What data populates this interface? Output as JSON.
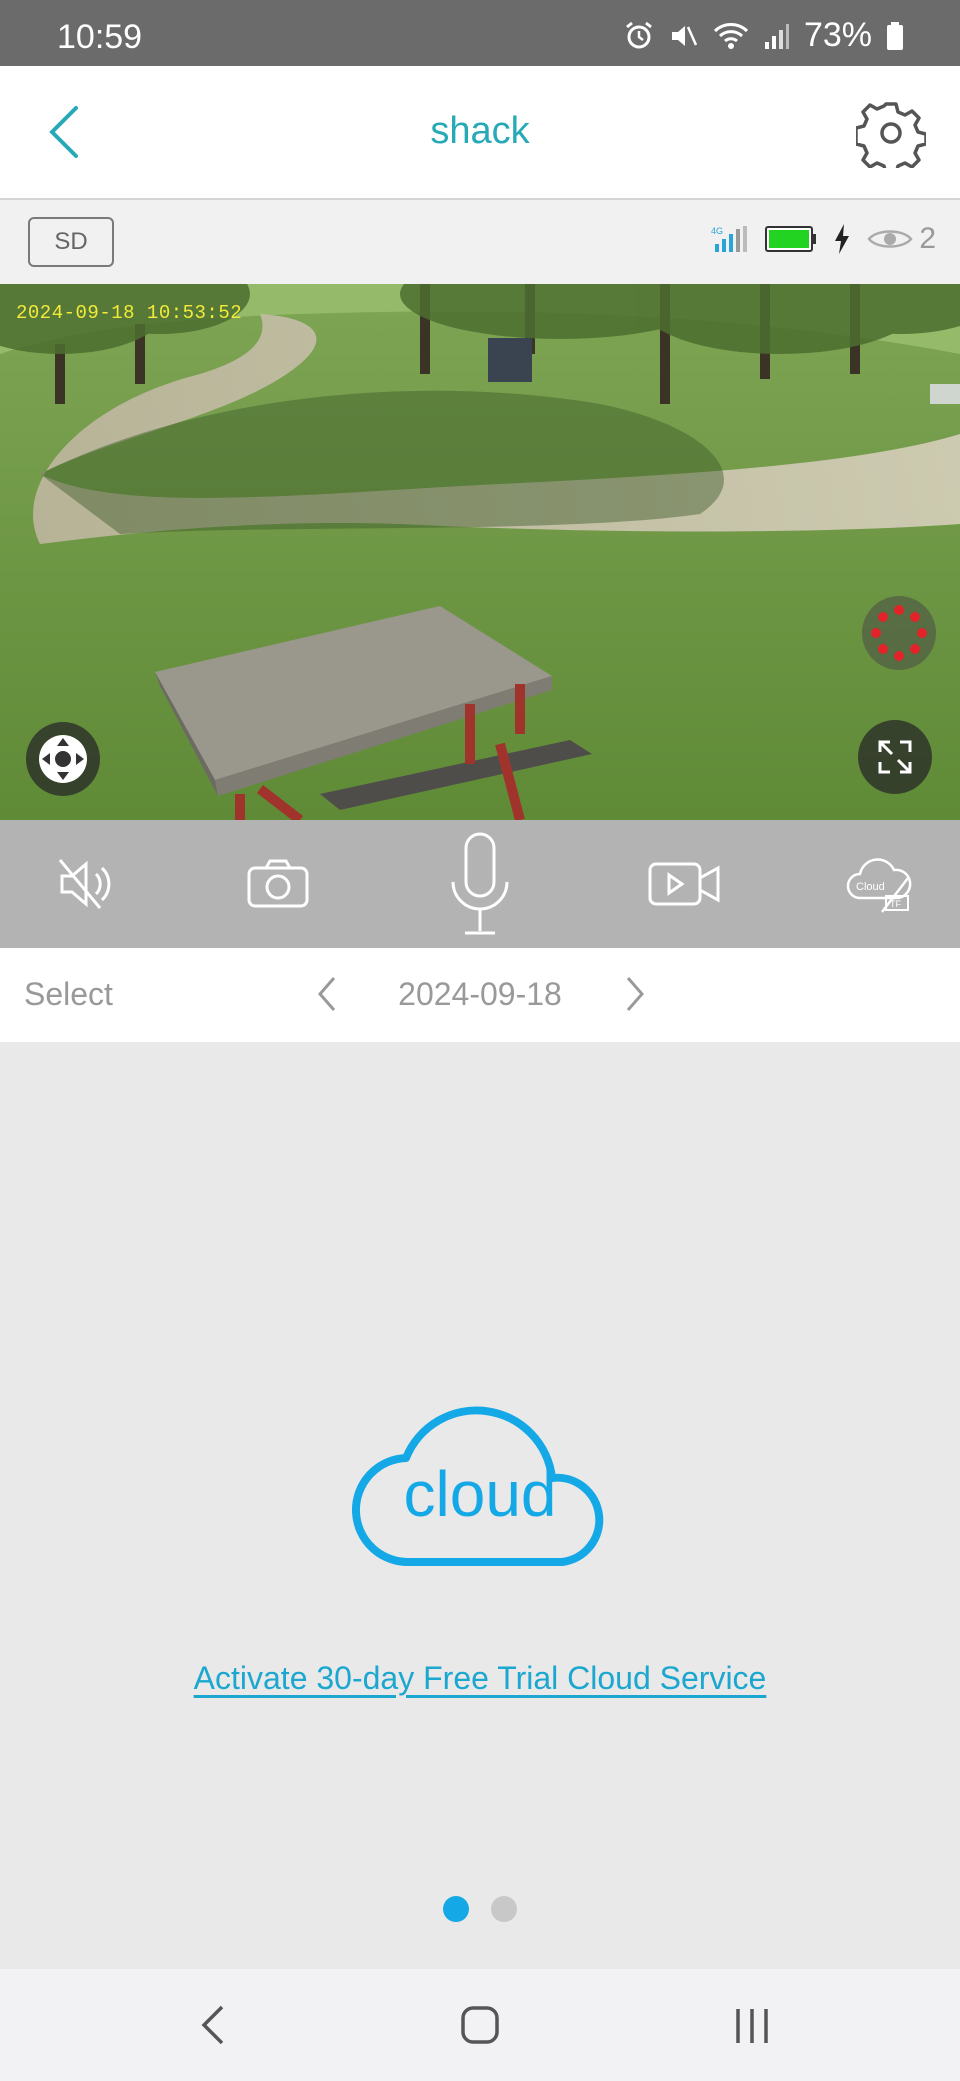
{
  "status_bar": {
    "time": "10:59",
    "battery": "73%",
    "icons": [
      "alarm-icon",
      "mute-icon",
      "wifi-icon",
      "signal-icon",
      "battery-icon"
    ]
  },
  "header": {
    "title": "shack",
    "back_icon": "chevron-left-icon",
    "settings_icon": "gear-icon",
    "accent": "#27a9b7"
  },
  "device_info": {
    "quality": "SD",
    "network": "4G",
    "battery_color": "#22d322",
    "viewer_count": "2"
  },
  "video": {
    "timestamp": "2024-09-18 10:53:52",
    "left_control_icon": "ptz-direction-icon",
    "right_top_control_icon": "record-indicator-icon",
    "fullscreen_icon": "fullscreen-icon"
  },
  "toolbar": {
    "items": [
      "speaker-mute-icon",
      "camera-snapshot-icon",
      "microphone-icon",
      "video-record-icon",
      "cloud-tf-icon"
    ],
    "cloud_label": "Cloud",
    "tf_label": "TF"
  },
  "date_bar": {
    "select_label": "Select",
    "date": "2024-09-18"
  },
  "cloud": {
    "logo_text": "cloud",
    "trial_link": "Activate 30-day Free Trial Cloud Service",
    "color": "#14a9e6"
  },
  "pager": {
    "count": 2,
    "active": 1
  }
}
